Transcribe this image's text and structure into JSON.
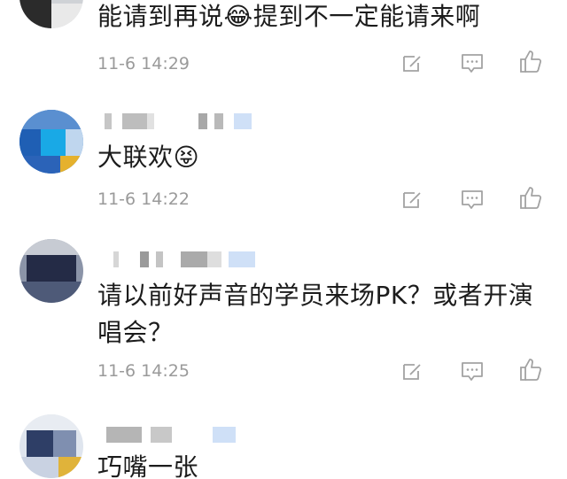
{
  "comments": [
    {
      "text": "能请到再说😂提到不一定能请来啊",
      "time": "11-6 14:29"
    },
    {
      "text": "大联欢😝",
      "time": "11-6 14:22"
    },
    {
      "text": "请以前好声音的学员来场PK？或者开演唱会？",
      "time": "11-6 14:25"
    },
    {
      "text": "巧嘴一张"
    }
  ],
  "icons": {
    "edit": "edit-icon",
    "reply": "comment-icon",
    "like": "thumbs-up-icon"
  }
}
